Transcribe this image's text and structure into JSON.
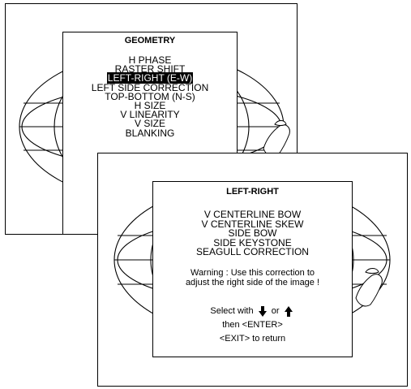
{
  "geometry_menu": {
    "title": "GEOMETRY",
    "items": [
      {
        "label": "H PHASE"
      },
      {
        "label": "RASTER SHIFT"
      },
      {
        "label": "LEFT-RIGHT (E-W)",
        "selected": true
      },
      {
        "label": "LEFT SIDE CORRECTION"
      },
      {
        "label": "TOP-BOTTOM (N-S)"
      },
      {
        "label": "H SIZE"
      },
      {
        "label": "V LINEARITY"
      },
      {
        "label": "V SIZE"
      },
      {
        "label": "BLANKING"
      }
    ]
  },
  "left_right_menu": {
    "title": "LEFT-RIGHT",
    "items": [
      {
        "label": "V CENTERLINE BOW"
      },
      {
        "label": "V CENTERLINE SKEW"
      },
      {
        "label": "SIDE BOW"
      },
      {
        "label": "SIDE KEYSTONE"
      },
      {
        "label": "SEAGULL CORRECTION"
      }
    ],
    "warning_line1": "Warning : Use this correction to",
    "warning_line2": "adjust the right side of the image !",
    "help_select": "Select with",
    "help_or": "or",
    "help_enter": "then <ENTER>",
    "help_exit": "<EXIT> to return",
    "arrow_down_icon": "arrow-down-icon",
    "arrow_up_icon": "arrow-up-icon"
  }
}
